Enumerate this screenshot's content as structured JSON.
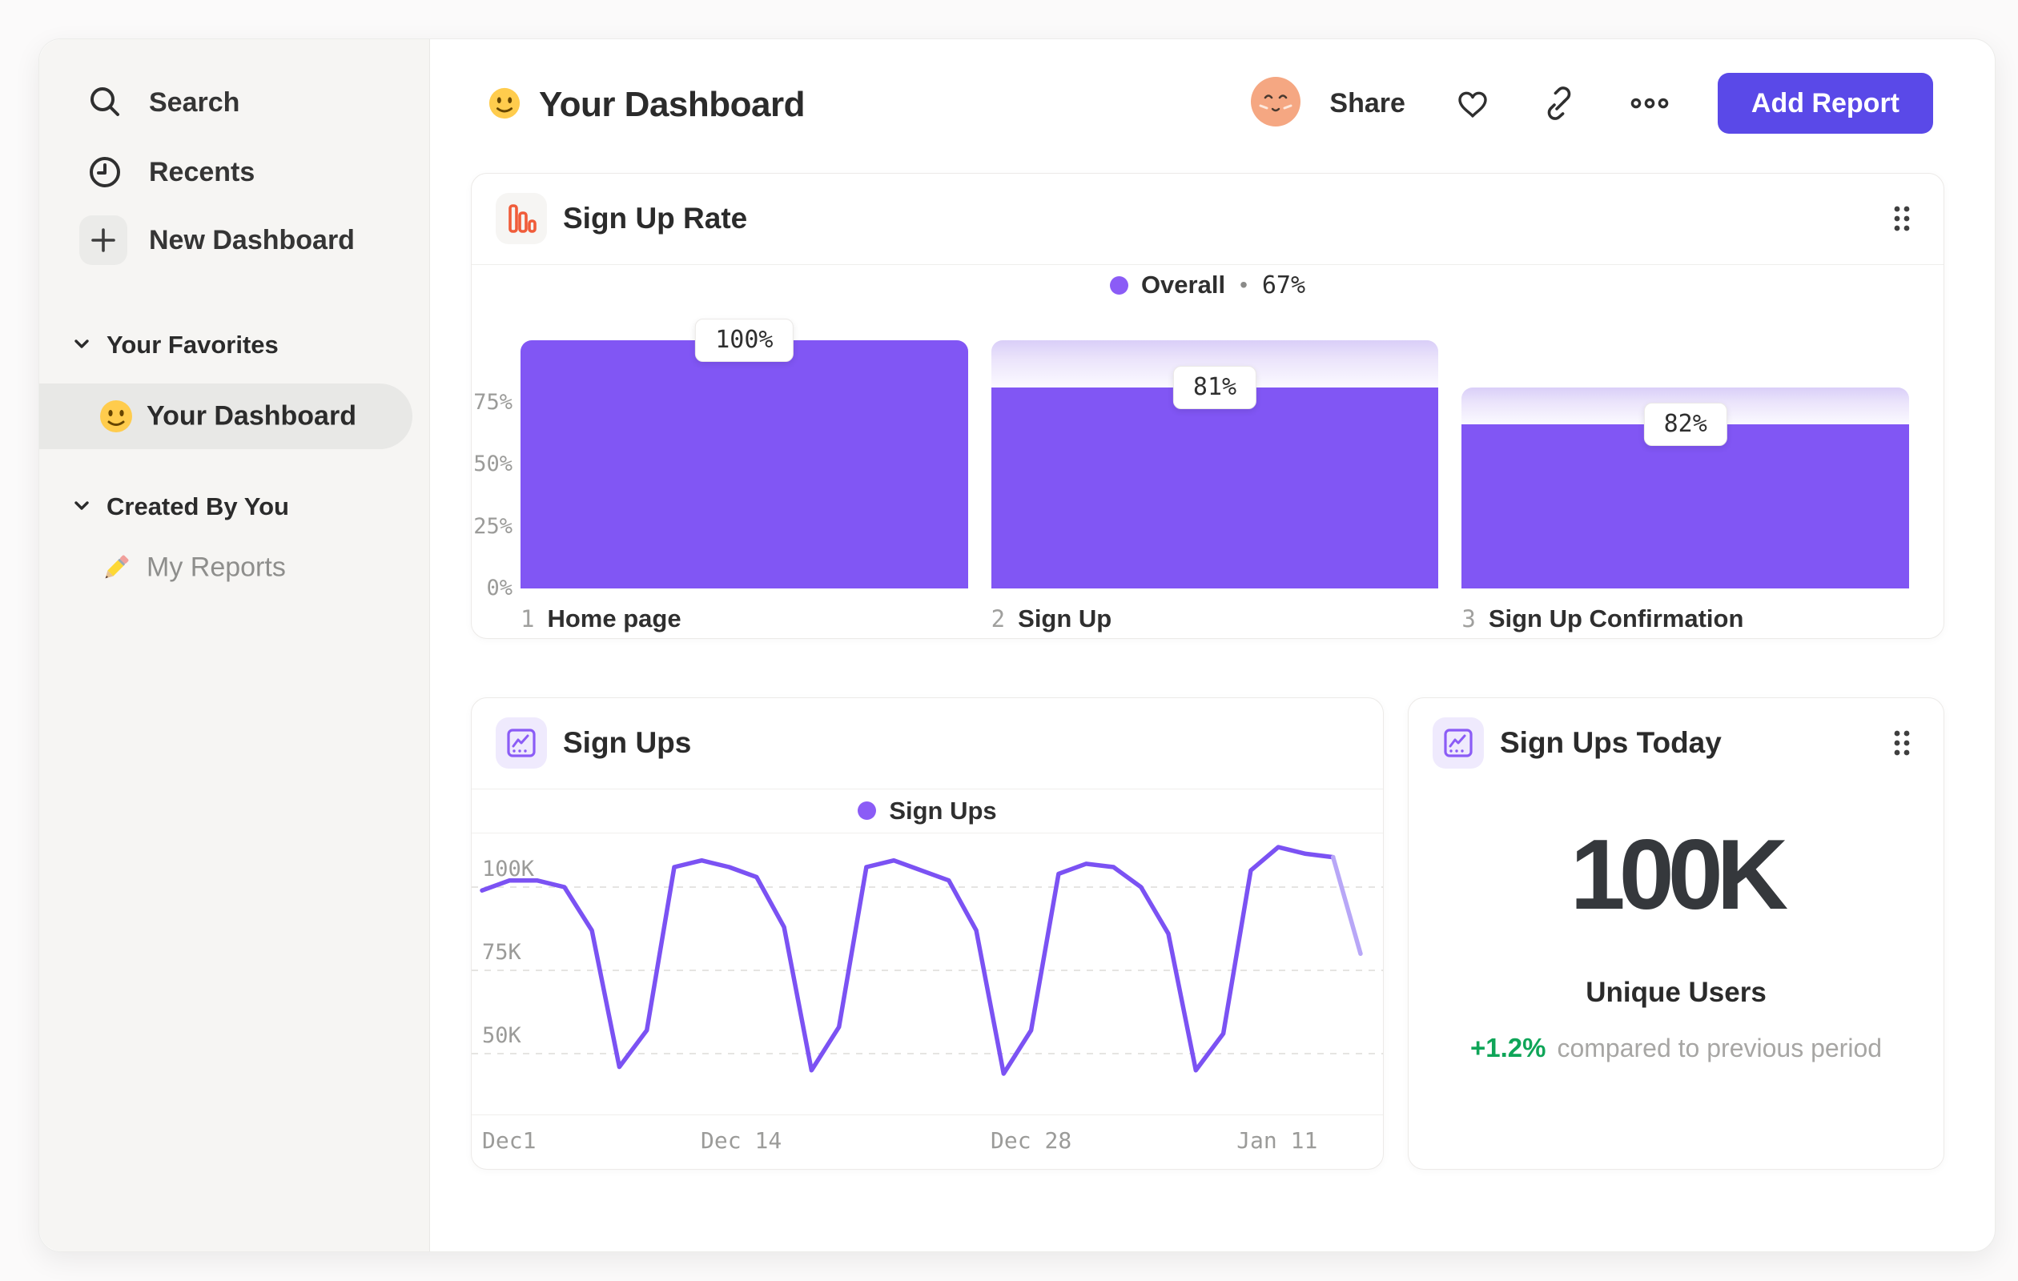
{
  "sidebar": {
    "nav": [
      {
        "label": "Search",
        "icon": "search-icon"
      },
      {
        "label": "Recents",
        "icon": "clock-icon"
      },
      {
        "label": "New Dashboard",
        "icon": "plus-icon"
      }
    ],
    "sections": [
      {
        "title": "Your Favorites",
        "items": [
          {
            "label": "Your Dashboard",
            "icon": "smiley-emoji",
            "active": true
          }
        ]
      },
      {
        "title": "Created By You",
        "items": [
          {
            "label": "My Reports",
            "icon": "pencil-emoji",
            "active": false
          }
        ]
      }
    ]
  },
  "header": {
    "title": "Your Dashboard",
    "title_icon": "smiley-emoji",
    "share_label": "Share",
    "add_report_label": "Add Report"
  },
  "cards": {
    "funnel": {
      "title": "Sign Up Rate",
      "legend_name": "Overall",
      "legend_sep": "•",
      "legend_value": "67%"
    },
    "line": {
      "title": "Sign Ups",
      "legend_name": "Sign Ups"
    },
    "number": {
      "title": "Sign Ups Today",
      "value": "100K",
      "label": "Unique Users",
      "delta": "+1.2%",
      "delta_note": "compared to previous period"
    }
  },
  "chart_data": [
    {
      "id": "sign-up-rate",
      "type": "bar",
      "subtype": "funnel",
      "title": "Sign Up Rate",
      "legend": "Overall",
      "overall_conversion": "67%",
      "ylim": [
        0,
        100
      ],
      "yticks": [
        {
          "value": 0,
          "label": "0%"
        },
        {
          "value": 25,
          "label": "25%"
        },
        {
          "value": 50,
          "label": "50%"
        },
        {
          "value": 75,
          "label": "75%"
        }
      ],
      "steps": [
        {
          "step": 1,
          "label": "Home page",
          "conversion_from_previous_pct": 100,
          "overall_pct": 100
        },
        {
          "step": 2,
          "label": "Sign Up",
          "conversion_from_previous_pct": 81,
          "overall_pct": 81
        },
        {
          "step": 3,
          "label": "Sign Up Confirmation",
          "conversion_from_previous_pct": 82,
          "overall_pct": 66
        }
      ]
    },
    {
      "id": "sign-ups",
      "type": "line",
      "title": "Sign Ups",
      "legend": "Sign Ups",
      "ylim_k": [
        30,
        115
      ],
      "grid": "dashed-horizontal",
      "yticks": [
        {
          "value": 100,
          "label": "100K"
        },
        {
          "value": 75,
          "label": "75K"
        },
        {
          "value": 50,
          "label": "50K"
        }
      ],
      "values_k": [
        99,
        102,
        102,
        100,
        87,
        46,
        57,
        106,
        108,
        106,
        103,
        88,
        45,
        58,
        106,
        108,
        105,
        102,
        87,
        44,
        57,
        104,
        107,
        106,
        100,
        86,
        45,
        56,
        105,
        112,
        110,
        109,
        80
      ],
      "faded_from_index": 31,
      "xticks": [
        {
          "pos": 0.0,
          "label": "Dec1",
          "align": "left"
        },
        {
          "pos": 0.295,
          "label": "Dec 14",
          "align": "center"
        },
        {
          "pos": 0.625,
          "label": "Dec 28",
          "align": "center"
        },
        {
          "pos": 0.905,
          "label": "Jan 11",
          "align": "center"
        }
      ]
    },
    {
      "id": "sign-ups-today",
      "type": "number",
      "title": "Sign Ups Today",
      "value": "100K",
      "label": "Unique Users",
      "delta_pct": "+1.2%",
      "comparison": "compared to previous period"
    }
  ],
  "colors": {
    "bar_purple": "#8156f4",
    "line_purple": "#7b52f3",
    "line_faded": "#b8a7f7",
    "legend_purple": "#8b5cf6",
    "button_purple": "#5a49e8",
    "orange_icon": "#f05c3a",
    "green_delta": "#0fa558",
    "sidebar_bg": "#f6f5f3"
  }
}
